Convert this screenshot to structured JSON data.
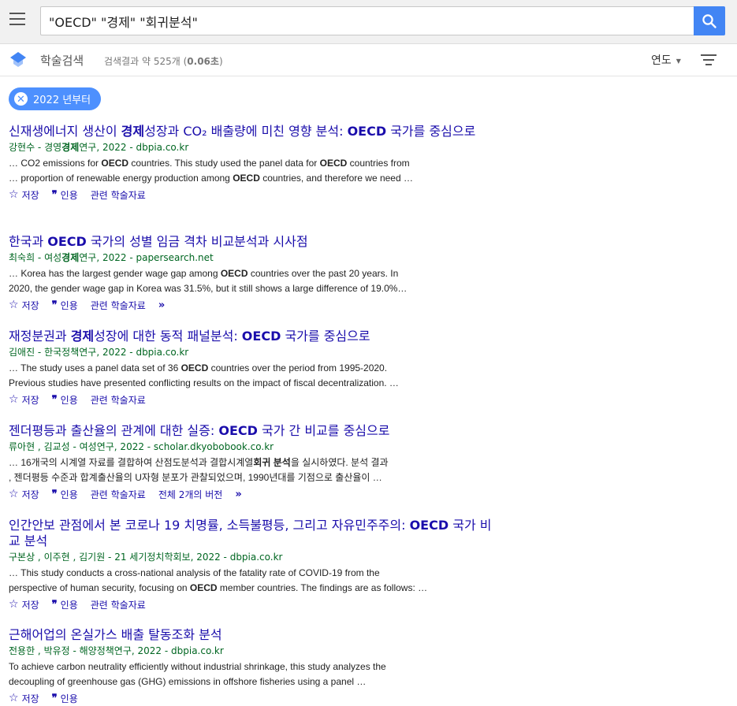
{
  "search": {
    "query": "\"OECD\" \"경제\" \"회귀분석\""
  },
  "subheader": {
    "scholar_label": "학술검색",
    "result_prefix": "검색결과 약 525개 (",
    "result_time": "0.06초",
    "result_suffix": ")",
    "sort_label": "연도"
  },
  "filter_chip": {
    "label": "2022 년부터"
  },
  "colors": {
    "accent": "#4285f4",
    "title_link": "#1a0dab",
    "meta_green": "#006621"
  },
  "results": [
    {
      "title_parts": [
        "신재생에너지 생산이 ",
        "경제",
        "성장과 CO₂ 배출량에 미친 영향 분석: ",
        "OECD",
        " 국가를 중심으로"
      ],
      "meta_parts": [
        "강현수 - 경영",
        "경제",
        "연구, 2022 - dbpia.co.kr"
      ],
      "snippet_line1": [
        "… CO2 emissions for ",
        "OECD",
        " countries. This study used the panel data for ",
        "OECD",
        " countries from"
      ],
      "snippet_line2": [
        "… proportion of renewable energy production among ",
        "OECD",
        " countries, and therefore we need …"
      ],
      "actions": [
        "저장",
        "인용",
        "관련 학술자료"
      ]
    },
    {
      "title_parts": [
        "한국과 ",
        "OECD",
        " 국가의 성별 임금 격차 비교분석과 시사점"
      ],
      "meta_parts": [
        "최숙희 - 여성",
        "경제",
        "연구, 2022 - papersearch.net"
      ],
      "snippet_line1": [
        "… Korea has the largest gender wage gap among ",
        "OECD",
        " countries over the past 20 years. In"
      ],
      "snippet_line2": [
        "2020, the gender wage gap in Korea was 31.5%, but it still shows a large difference of 19.0%…"
      ],
      "actions": [
        "저장",
        "인용",
        "관련 학술자료"
      ]
    },
    {
      "title_parts": [
        "재정분권과 ",
        "경제",
        "성장에 대한 동적 패널분석: ",
        "OECD",
        " 국가를 중심으로"
      ],
      "meta_parts": [
        "김애진 - 한국정책연구, 2022 - dbpia.co.kr"
      ],
      "snippet_line1": [
        "… The study uses a panel data set of 36 ",
        "OECD",
        " countries over the period from 1995-2020."
      ],
      "snippet_line2": [
        "Previous studies have presented conflicting results on the impact of fiscal decentralization. …"
      ],
      "actions": [
        "저장",
        "인용",
        "관련 학술자료"
      ]
    },
    {
      "title_parts": [
        "젠더평등과 출산율의 관계에 대한 실증: ",
        "OECD",
        " 국가 간 비교를 중심으로"
      ],
      "meta_parts": [
        "류아현 ,  김교성 - 여성연구, 2022 - scholar.dkyobobook.co.kr"
      ],
      "snippet_line1": [
        "… 16개국의 시계열 자료를 결합하여 산점도분석과 결합시계열",
        "회귀 분석",
        "을 실시하였다. 분석 결과"
      ],
      "snippet_line2": [
        ", 젠더평등 수준과 합계출산율의 U자형 분포가 관찰되었으며, 1990년대를 기점으로 출산율이 …"
      ],
      "actions": [
        "저장",
        "인용",
        "관련 학술자료",
        "전체 2개의 버전"
      ]
    },
    {
      "title_parts": [
        "인간안보 관점에서 본 코로나 19 치명률, 소득불평등, 그리고 자유민주주의: ",
        "OECD",
        " 국가 비교 분석"
      ],
      "meta_parts": [
        "구본상 ,  이주현 ,  김기원 - 21 세기정치학회보, 2022 - dbpia.co.kr"
      ],
      "snippet_line1": [
        "… This study conducts a cross-national analysis of the fatality rate of COVID-19 from the"
      ],
      "snippet_line2": [
        "perspective of human security, focusing on ",
        "OECD",
        " member countries. The findings are as follows: …"
      ],
      "actions": [
        "저장",
        "인용",
        "관련 학술자료"
      ]
    },
    {
      "title_parts": [
        "근해어업의 온실가스 배출 탈동조화 분석"
      ],
      "meta_parts": [
        "전용한 ,  박유정 - 해양정책연구, 2022 - dbpia.co.kr"
      ],
      "snippet_line1": [
        "To achieve carbon neutrality efficiently without industrial shrinkage, this study analyzes the"
      ],
      "snippet_line2": [
        "decoupling of greenhouse gas (GHG) emissions in offshore fisheries using a panel …"
      ],
      "actions": [
        "저장",
        "인용"
      ]
    }
  ]
}
